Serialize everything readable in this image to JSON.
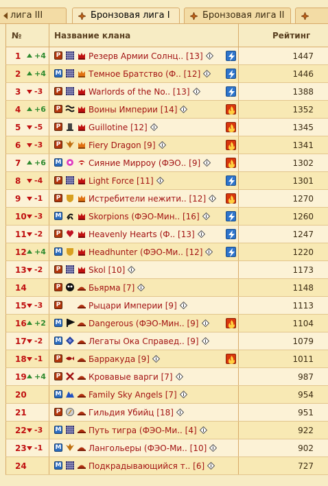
{
  "tabs": [
    {
      "label": "лига III",
      "active": false
    },
    {
      "label": "Бронзовая лига I",
      "active": true
    },
    {
      "label": "Бронзовая лига II",
      "active": false
    },
    {
      "label": "",
      "active": false
    }
  ],
  "headers": {
    "num": "№",
    "name": "Название клана",
    "rating": "Рейтинг"
  },
  "colors": {
    "accent_red": "#c01010",
    "up_green": "#2e8a2e",
    "row_odd": "#fcf2d6",
    "row_even": "#f8e9b4"
  },
  "rows": [
    {
      "num": "1",
      "dir": "up",
      "delta": "+4",
      "type": "P",
      "emblem": "grid",
      "rank": "crown-red",
      "name": "Резерв Армии Солнц.. [13]",
      "elem": "lightning",
      "rating": "1447"
    },
    {
      "num": "2",
      "dir": "up",
      "delta": "+4",
      "type": "M",
      "emblem": "grid",
      "rank": "crown-orange",
      "name": "Темное Братство (Ф.. [12]",
      "elem": "lightning",
      "rating": "1446"
    },
    {
      "num": "3",
      "dir": "down",
      "delta": "-3",
      "type": "P",
      "emblem": "grid",
      "rank": "crown-red",
      "name": "Warlords of the No.. [13]",
      "elem": "lightning",
      "rating": "1388"
    },
    {
      "num": "4",
      "dir": "up",
      "delta": "+6",
      "type": "P",
      "emblem": "wave",
      "rank": "crown-red",
      "name": "Воины Империи [14]",
      "elem": "fire",
      "rating": "1352"
    },
    {
      "num": "5",
      "dir": "down",
      "delta": "-5",
      "type": "P",
      "emblem": "tower",
      "rank": "crown-red",
      "name": "Guillotine [12]",
      "elem": "fire",
      "rating": "1345"
    },
    {
      "num": "6",
      "dir": "down",
      "delta": "-3",
      "type": "P",
      "emblem": "wings",
      "rank": "crown-orange",
      "name": "Fiery Dragon [9]",
      "elem": "fire",
      "rating": "1341"
    },
    {
      "num": "7",
      "dir": "up",
      "delta": "+6",
      "type": "M",
      "emblem": "star",
      "rank": "bird",
      "name": "Сияние Мирроу (ФЭО.. [9]",
      "elem": "fire",
      "rating": "1302"
    },
    {
      "num": "8",
      "dir": "down",
      "delta": "-4",
      "type": "P",
      "emblem": "grid",
      "rank": "crown-red",
      "name": "Light Force [11]",
      "elem": "lightning",
      "rating": "1301"
    },
    {
      "num": "9",
      "dir": "down",
      "delta": "-1",
      "type": "P",
      "emblem": "shield",
      "rank": "crown-orange",
      "name": "Истребители нежити.. [12]",
      "elem": "fire",
      "rating": "1270"
    },
    {
      "num": "10",
      "dir": "down",
      "delta": "-3",
      "type": "M",
      "emblem": "scorpion",
      "rank": "crown-red",
      "name": "Skorpions (ФЭО-Мин.. [16]",
      "elem": "lightning",
      "rating": "1260"
    },
    {
      "num": "11",
      "dir": "down",
      "delta": "-2",
      "type": "P",
      "emblem": "heart",
      "rank": "crown-red",
      "name": "Heavenly Hearts (Ф.. [13]",
      "elem": "lightning",
      "rating": "1247"
    },
    {
      "num": "12",
      "dir": "up",
      "delta": "+4",
      "type": "M",
      "emblem": "shield",
      "rank": "crown-red",
      "name": "Headhunter (ФЭО-Ми.. [12]",
      "elem": "lightning",
      "rating": "1220"
    },
    {
      "num": "13",
      "dir": "down",
      "delta": "-2",
      "type": "P",
      "emblem": "grid",
      "rank": "crown-red",
      "name": "Skol [10]",
      "elem": "",
      "rating": "1173"
    },
    {
      "num": "14",
      "dir": "",
      "delta": "",
      "type": "P",
      "emblem": "skull",
      "rank": "hat",
      "name": "Бьярма [7]",
      "elem": "",
      "rating": "1148"
    },
    {
      "num": "15",
      "dir": "down",
      "delta": "-3",
      "type": "P",
      "emblem": "",
      "rank": "hat",
      "name": "Рыцари Империи [9]",
      "elem": "",
      "rating": "1113"
    },
    {
      "num": "16",
      "dir": "up",
      "delta": "+2",
      "type": "M",
      "emblem": "flag",
      "rank": "hat",
      "name": "Dangerous (ФЭО-Мин.. [9]",
      "elem": "fire",
      "rating": "1104"
    },
    {
      "num": "17",
      "dir": "down",
      "delta": "-2",
      "type": "M",
      "emblem": "diamond",
      "rank": "hat",
      "name": "Легаты Ока Справед.. [9]",
      "elem": "",
      "rating": "1079"
    },
    {
      "num": "18",
      "dir": "down",
      "delta": "-1",
      "type": "P",
      "emblem": "fish",
      "rank": "hat",
      "name": "Барракуда [9]",
      "elem": "fire",
      "rating": "1011"
    },
    {
      "num": "19",
      "dir": "up",
      "delta": "+4",
      "type": "P",
      "emblem": "cross",
      "rank": "hat",
      "name": "Кровавые варги [7]",
      "elem": "",
      "rating": "987"
    },
    {
      "num": "20",
      "dir": "",
      "delta": "",
      "type": "M",
      "emblem": "mountain",
      "rank": "hat",
      "name": "Family Sky Angels [7]",
      "elem": "",
      "rating": "954"
    },
    {
      "num": "21",
      "dir": "",
      "delta": "",
      "type": "P",
      "emblem": "circle",
      "rank": "hat",
      "name": "Гильдия Убийц [18]",
      "elem": "",
      "rating": "951"
    },
    {
      "num": "22",
      "dir": "down",
      "delta": "-3",
      "type": "M",
      "emblem": "grid",
      "rank": "hat",
      "name": "Путь тигра (ФЭО-Ми.. [4]",
      "elem": "",
      "rating": "922"
    },
    {
      "num": "23",
      "dir": "down",
      "delta": "-1",
      "type": "M",
      "emblem": "wings",
      "rank": "hat",
      "name": "Лангольеры (ФЭО-Ми.. [10]",
      "elem": "",
      "rating": "902"
    },
    {
      "num": "24",
      "dir": "",
      "delta": "",
      "type": "M",
      "emblem": "grid",
      "rank": "hat",
      "name": "Подкрадывающийся т.. [6]",
      "elem": "",
      "rating": "727"
    }
  ]
}
